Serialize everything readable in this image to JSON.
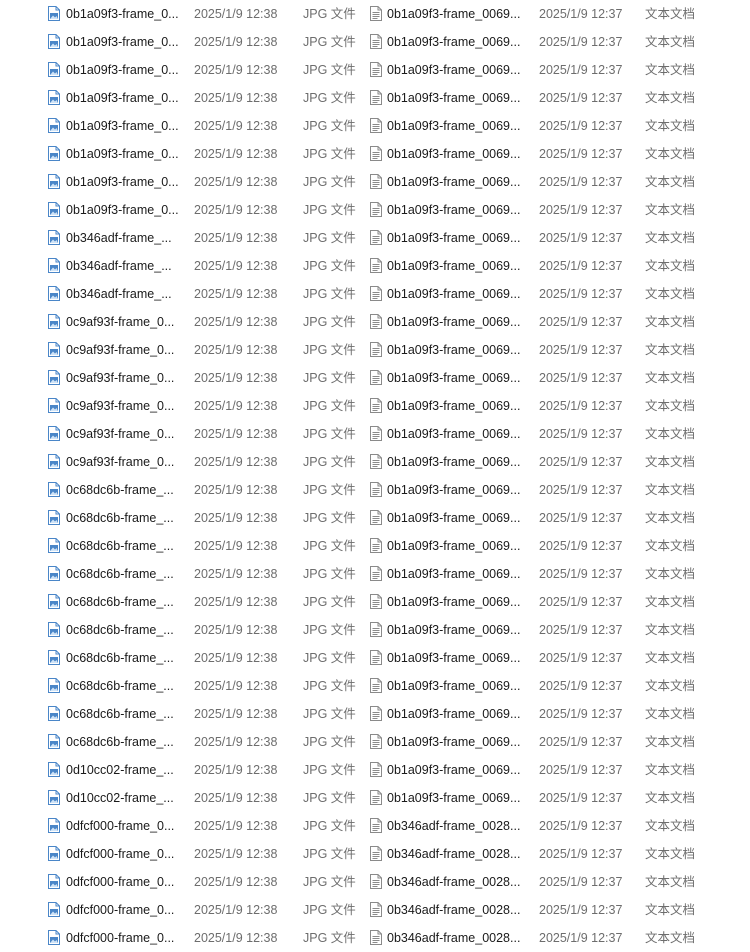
{
  "colors": {
    "image_icon": "#4a86c8",
    "text_icon": "#8a8a8a",
    "secondary_text": "#6d6d6d"
  },
  "left_pane": {
    "icon": "image-file-icon",
    "rows": [
      {
        "name": "0b1a09f3-frame_0...",
        "date": "2025/1/9 12:38",
        "type": "JPG 文件"
      },
      {
        "name": "0b1a09f3-frame_0...",
        "date": "2025/1/9 12:38",
        "type": "JPG 文件"
      },
      {
        "name": "0b1a09f3-frame_0...",
        "date": "2025/1/9 12:38",
        "type": "JPG 文件"
      },
      {
        "name": "0b1a09f3-frame_0...",
        "date": "2025/1/9 12:38",
        "type": "JPG 文件"
      },
      {
        "name": "0b1a09f3-frame_0...",
        "date": "2025/1/9 12:38",
        "type": "JPG 文件"
      },
      {
        "name": "0b1a09f3-frame_0...",
        "date": "2025/1/9 12:38",
        "type": "JPG 文件"
      },
      {
        "name": "0b1a09f3-frame_0...",
        "date": "2025/1/9 12:38",
        "type": "JPG 文件"
      },
      {
        "name": "0b1a09f3-frame_0...",
        "date": "2025/1/9 12:38",
        "type": "JPG 文件"
      },
      {
        "name": "0b346adf-frame_...",
        "date": "2025/1/9 12:38",
        "type": "JPG 文件"
      },
      {
        "name": "0b346adf-frame_...",
        "date": "2025/1/9 12:38",
        "type": "JPG 文件"
      },
      {
        "name": "0b346adf-frame_...",
        "date": "2025/1/9 12:38",
        "type": "JPG 文件"
      },
      {
        "name": "0c9af93f-frame_0...",
        "date": "2025/1/9 12:38",
        "type": "JPG 文件"
      },
      {
        "name": "0c9af93f-frame_0...",
        "date": "2025/1/9 12:38",
        "type": "JPG 文件"
      },
      {
        "name": "0c9af93f-frame_0...",
        "date": "2025/1/9 12:38",
        "type": "JPG 文件"
      },
      {
        "name": "0c9af93f-frame_0...",
        "date": "2025/1/9 12:38",
        "type": "JPG 文件"
      },
      {
        "name": "0c9af93f-frame_0...",
        "date": "2025/1/9 12:38",
        "type": "JPG 文件"
      },
      {
        "name": "0c9af93f-frame_0...",
        "date": "2025/1/9 12:38",
        "type": "JPG 文件"
      },
      {
        "name": "0c68dc6b-frame_...",
        "date": "2025/1/9 12:38",
        "type": "JPG 文件"
      },
      {
        "name": "0c68dc6b-frame_...",
        "date": "2025/1/9 12:38",
        "type": "JPG 文件"
      },
      {
        "name": "0c68dc6b-frame_...",
        "date": "2025/1/9 12:38",
        "type": "JPG 文件"
      },
      {
        "name": "0c68dc6b-frame_...",
        "date": "2025/1/9 12:38",
        "type": "JPG 文件"
      },
      {
        "name": "0c68dc6b-frame_...",
        "date": "2025/1/9 12:38",
        "type": "JPG 文件"
      },
      {
        "name": "0c68dc6b-frame_...",
        "date": "2025/1/9 12:38",
        "type": "JPG 文件"
      },
      {
        "name": "0c68dc6b-frame_...",
        "date": "2025/1/9 12:38",
        "type": "JPG 文件"
      },
      {
        "name": "0c68dc6b-frame_...",
        "date": "2025/1/9 12:38",
        "type": "JPG 文件"
      },
      {
        "name": "0c68dc6b-frame_...",
        "date": "2025/1/9 12:38",
        "type": "JPG 文件"
      },
      {
        "name": "0c68dc6b-frame_...",
        "date": "2025/1/9 12:38",
        "type": "JPG 文件"
      },
      {
        "name": "0d10cc02-frame_...",
        "date": "2025/1/9 12:38",
        "type": "JPG 文件"
      },
      {
        "name": "0d10cc02-frame_...",
        "date": "2025/1/9 12:38",
        "type": "JPG 文件"
      },
      {
        "name": "0dfcf000-frame_0...",
        "date": "2025/1/9 12:38",
        "type": "JPG 文件"
      },
      {
        "name": "0dfcf000-frame_0...",
        "date": "2025/1/9 12:38",
        "type": "JPG 文件"
      },
      {
        "name": "0dfcf000-frame_0...",
        "date": "2025/1/9 12:38",
        "type": "JPG 文件"
      },
      {
        "name": "0dfcf000-frame_0...",
        "date": "2025/1/9 12:38",
        "type": "JPG 文件"
      },
      {
        "name": "0dfcf000-frame_0...",
        "date": "2025/1/9 12:38",
        "type": "JPG 文件"
      }
    ]
  },
  "right_pane": {
    "icon": "text-file-icon",
    "rows": [
      {
        "name": "0b1a09f3-frame_0069...",
        "date": "2025/1/9 12:37",
        "type": "文本文档"
      },
      {
        "name": "0b1a09f3-frame_0069...",
        "date": "2025/1/9 12:37",
        "type": "文本文档"
      },
      {
        "name": "0b1a09f3-frame_0069...",
        "date": "2025/1/9 12:37",
        "type": "文本文档"
      },
      {
        "name": "0b1a09f3-frame_0069...",
        "date": "2025/1/9 12:37",
        "type": "文本文档"
      },
      {
        "name": "0b1a09f3-frame_0069...",
        "date": "2025/1/9 12:37",
        "type": "文本文档"
      },
      {
        "name": "0b1a09f3-frame_0069...",
        "date": "2025/1/9 12:37",
        "type": "文本文档"
      },
      {
        "name": "0b1a09f3-frame_0069...",
        "date": "2025/1/9 12:37",
        "type": "文本文档"
      },
      {
        "name": "0b1a09f3-frame_0069...",
        "date": "2025/1/9 12:37",
        "type": "文本文档"
      },
      {
        "name": "0b1a09f3-frame_0069...",
        "date": "2025/1/9 12:37",
        "type": "文本文档"
      },
      {
        "name": "0b1a09f3-frame_0069...",
        "date": "2025/1/9 12:37",
        "type": "文本文档"
      },
      {
        "name": "0b1a09f3-frame_0069...",
        "date": "2025/1/9 12:37",
        "type": "文本文档"
      },
      {
        "name": "0b1a09f3-frame_0069...",
        "date": "2025/1/9 12:37",
        "type": "文本文档"
      },
      {
        "name": "0b1a09f3-frame_0069...",
        "date": "2025/1/9 12:37",
        "type": "文本文档"
      },
      {
        "name": "0b1a09f3-frame_0069...",
        "date": "2025/1/9 12:37",
        "type": "文本文档"
      },
      {
        "name": "0b1a09f3-frame_0069...",
        "date": "2025/1/9 12:37",
        "type": "文本文档"
      },
      {
        "name": "0b1a09f3-frame_0069...",
        "date": "2025/1/9 12:37",
        "type": "文本文档"
      },
      {
        "name": "0b1a09f3-frame_0069...",
        "date": "2025/1/9 12:37",
        "type": "文本文档"
      },
      {
        "name": "0b1a09f3-frame_0069...",
        "date": "2025/1/9 12:37",
        "type": "文本文档"
      },
      {
        "name": "0b1a09f3-frame_0069...",
        "date": "2025/1/9 12:37",
        "type": "文本文档"
      },
      {
        "name": "0b1a09f3-frame_0069...",
        "date": "2025/1/9 12:37",
        "type": "文本文档"
      },
      {
        "name": "0b1a09f3-frame_0069...",
        "date": "2025/1/9 12:37",
        "type": "文本文档"
      },
      {
        "name": "0b1a09f3-frame_0069...",
        "date": "2025/1/9 12:37",
        "type": "文本文档"
      },
      {
        "name": "0b1a09f3-frame_0069...",
        "date": "2025/1/9 12:37",
        "type": "文本文档"
      },
      {
        "name": "0b1a09f3-frame_0069...",
        "date": "2025/1/9 12:37",
        "type": "文本文档"
      },
      {
        "name": "0b1a09f3-frame_0069...",
        "date": "2025/1/9 12:37",
        "type": "文本文档"
      },
      {
        "name": "0b1a09f3-frame_0069...",
        "date": "2025/1/9 12:37",
        "type": "文本文档"
      },
      {
        "name": "0b1a09f3-frame_0069...",
        "date": "2025/1/9 12:37",
        "type": "文本文档"
      },
      {
        "name": "0b1a09f3-frame_0069...",
        "date": "2025/1/9 12:37",
        "type": "文本文档"
      },
      {
        "name": "0b1a09f3-frame_0069...",
        "date": "2025/1/9 12:37",
        "type": "文本文档"
      },
      {
        "name": "0b346adf-frame_0028...",
        "date": "2025/1/9 12:37",
        "type": "文本文档"
      },
      {
        "name": "0b346adf-frame_0028...",
        "date": "2025/1/9 12:37",
        "type": "文本文档"
      },
      {
        "name": "0b346adf-frame_0028...",
        "date": "2025/1/9 12:37",
        "type": "文本文档"
      },
      {
        "name": "0b346adf-frame_0028...",
        "date": "2025/1/9 12:37",
        "type": "文本文档"
      },
      {
        "name": "0b346adf-frame_0028...",
        "date": "2025/1/9 12:37",
        "type": "文本文档"
      }
    ]
  }
}
